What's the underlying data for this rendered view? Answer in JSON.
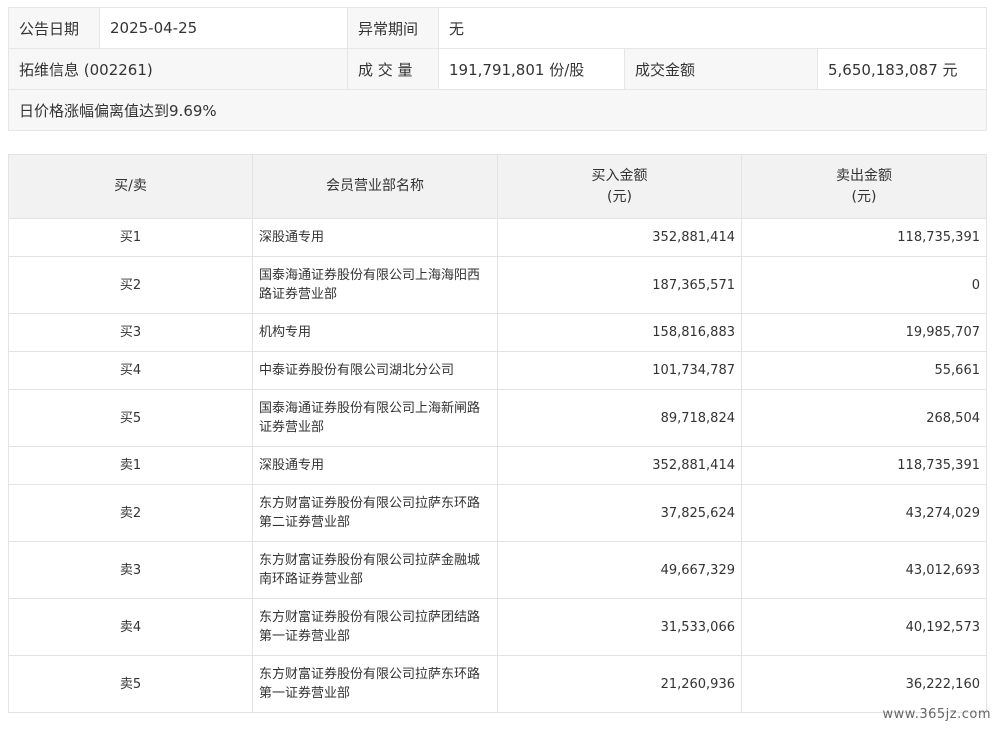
{
  "info": {
    "date_label": "公告日期",
    "date_value": "2025-04-25",
    "period_label": "异常期间",
    "period_value": "无",
    "stock_name": "拓维信息 (002261)",
    "volume_label": "成 交 量",
    "volume_value": "191,791,801 份/股",
    "amount_label": "成交金额",
    "amount_value": "5,650,183,087 元",
    "reason": "日价格涨幅偏离值达到9.69%"
  },
  "table": {
    "headers": {
      "side": "买/卖",
      "name": "会员营业部名称",
      "buy_line1": "买入金额",
      "buy_line2": "(元)",
      "sell_line1": "卖出金额",
      "sell_line2": "(元)"
    },
    "rows": [
      {
        "side": "买1",
        "name": "深股通专用",
        "buy": "352,881,414",
        "sell": "118,735,391"
      },
      {
        "side": "买2",
        "name": "国泰海通证券股份有限公司上海海阳西路证券营业部",
        "buy": "187,365,571",
        "sell": "0"
      },
      {
        "side": "买3",
        "name": "机构专用",
        "buy": "158,816,883",
        "sell": "19,985,707"
      },
      {
        "side": "买4",
        "name": "中泰证券股份有限公司湖北分公司",
        "buy": "101,734,787",
        "sell": "55,661"
      },
      {
        "side": "买5",
        "name": "国泰海通证券股份有限公司上海新闸路证券营业部",
        "buy": "89,718,824",
        "sell": "268,504"
      },
      {
        "side": "卖1",
        "name": "深股通专用",
        "buy": "352,881,414",
        "sell": "118,735,391"
      },
      {
        "side": "卖2",
        "name": "东方财富证券股份有限公司拉萨东环路第二证券营业部",
        "buy": "37,825,624",
        "sell": "43,274,029"
      },
      {
        "side": "卖3",
        "name": "东方财富证券股份有限公司拉萨金融城南环路证券营业部",
        "buy": "49,667,329",
        "sell": "43,012,693"
      },
      {
        "side": "卖4",
        "name": "东方财富证券股份有限公司拉萨团结路第一证券营业部",
        "buy": "31,533,066",
        "sell": "40,192,573"
      },
      {
        "side": "卖5",
        "name": "东方财富证券股份有限公司拉萨东环路第一证券营业部",
        "buy": "21,260,936",
        "sell": "36,222,160"
      }
    ]
  },
  "watermark": "www.365jz.com"
}
